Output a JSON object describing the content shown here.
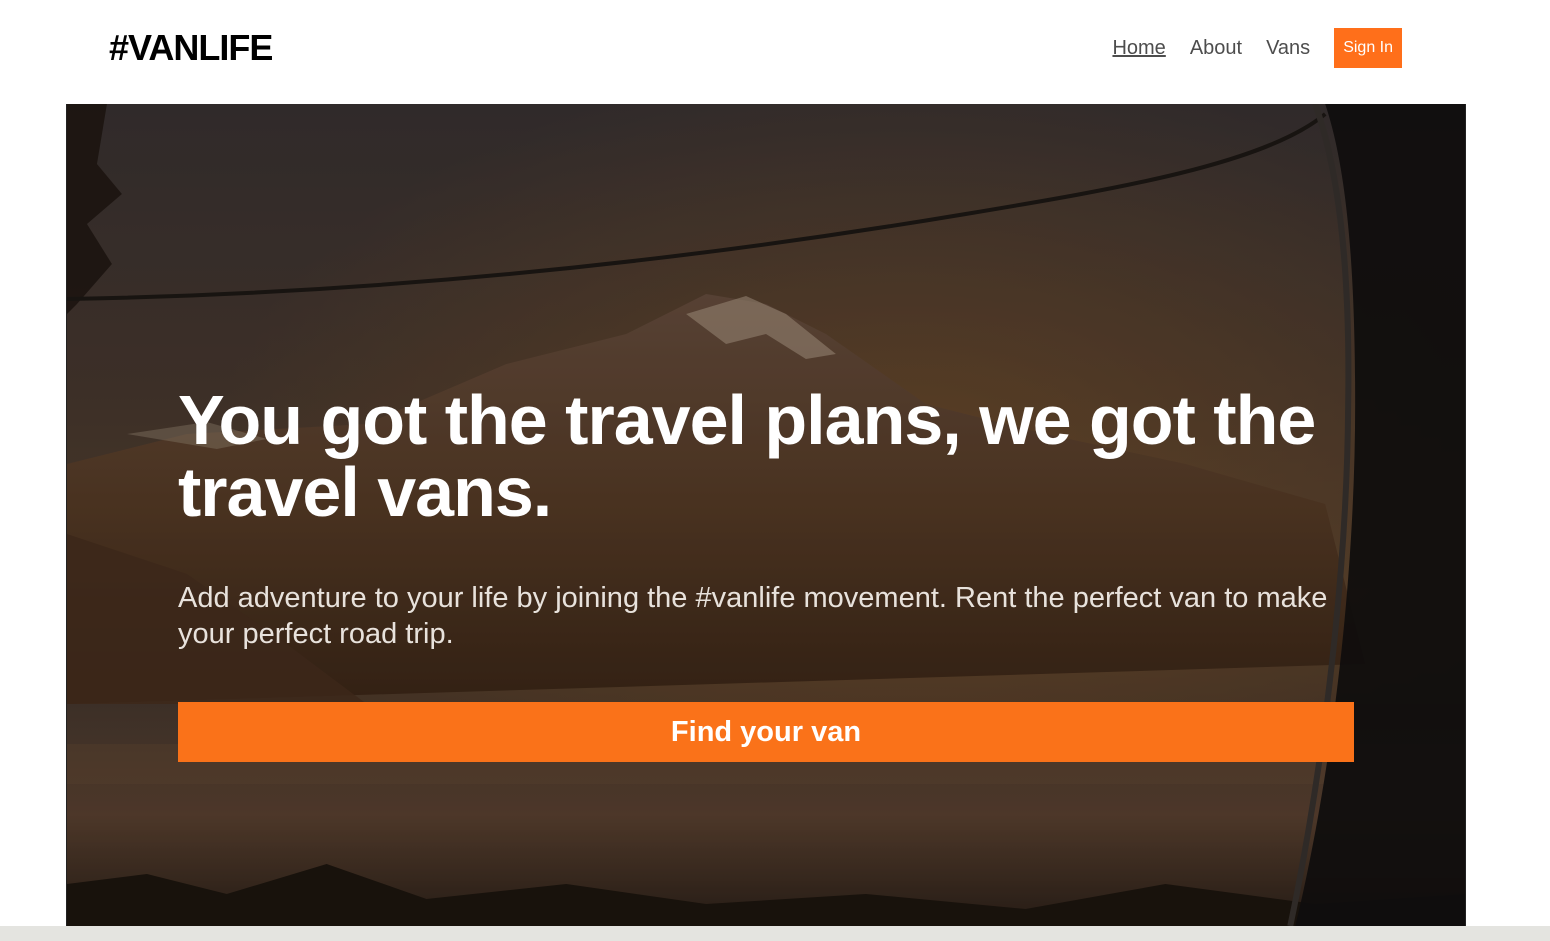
{
  "header": {
    "logo": "#VANLIFE",
    "nav": {
      "home": "Home",
      "about": "About",
      "vans": "Vans",
      "sign_in": "Sign In"
    }
  },
  "hero": {
    "title": "You got the travel plans, we got the travel vans.",
    "subtitle": "Add adventure to your life by joining the #vanlife movement. Rent the perfect van to make your perfect road trip.",
    "cta_label": "Find your van",
    "background": "mountain-lake-through-van-window-photo"
  },
  "colors": {
    "accent": "#ff6f1a",
    "cta": "#fa7219",
    "text_dark": "#000000",
    "nav_text": "#4d4d4d"
  }
}
